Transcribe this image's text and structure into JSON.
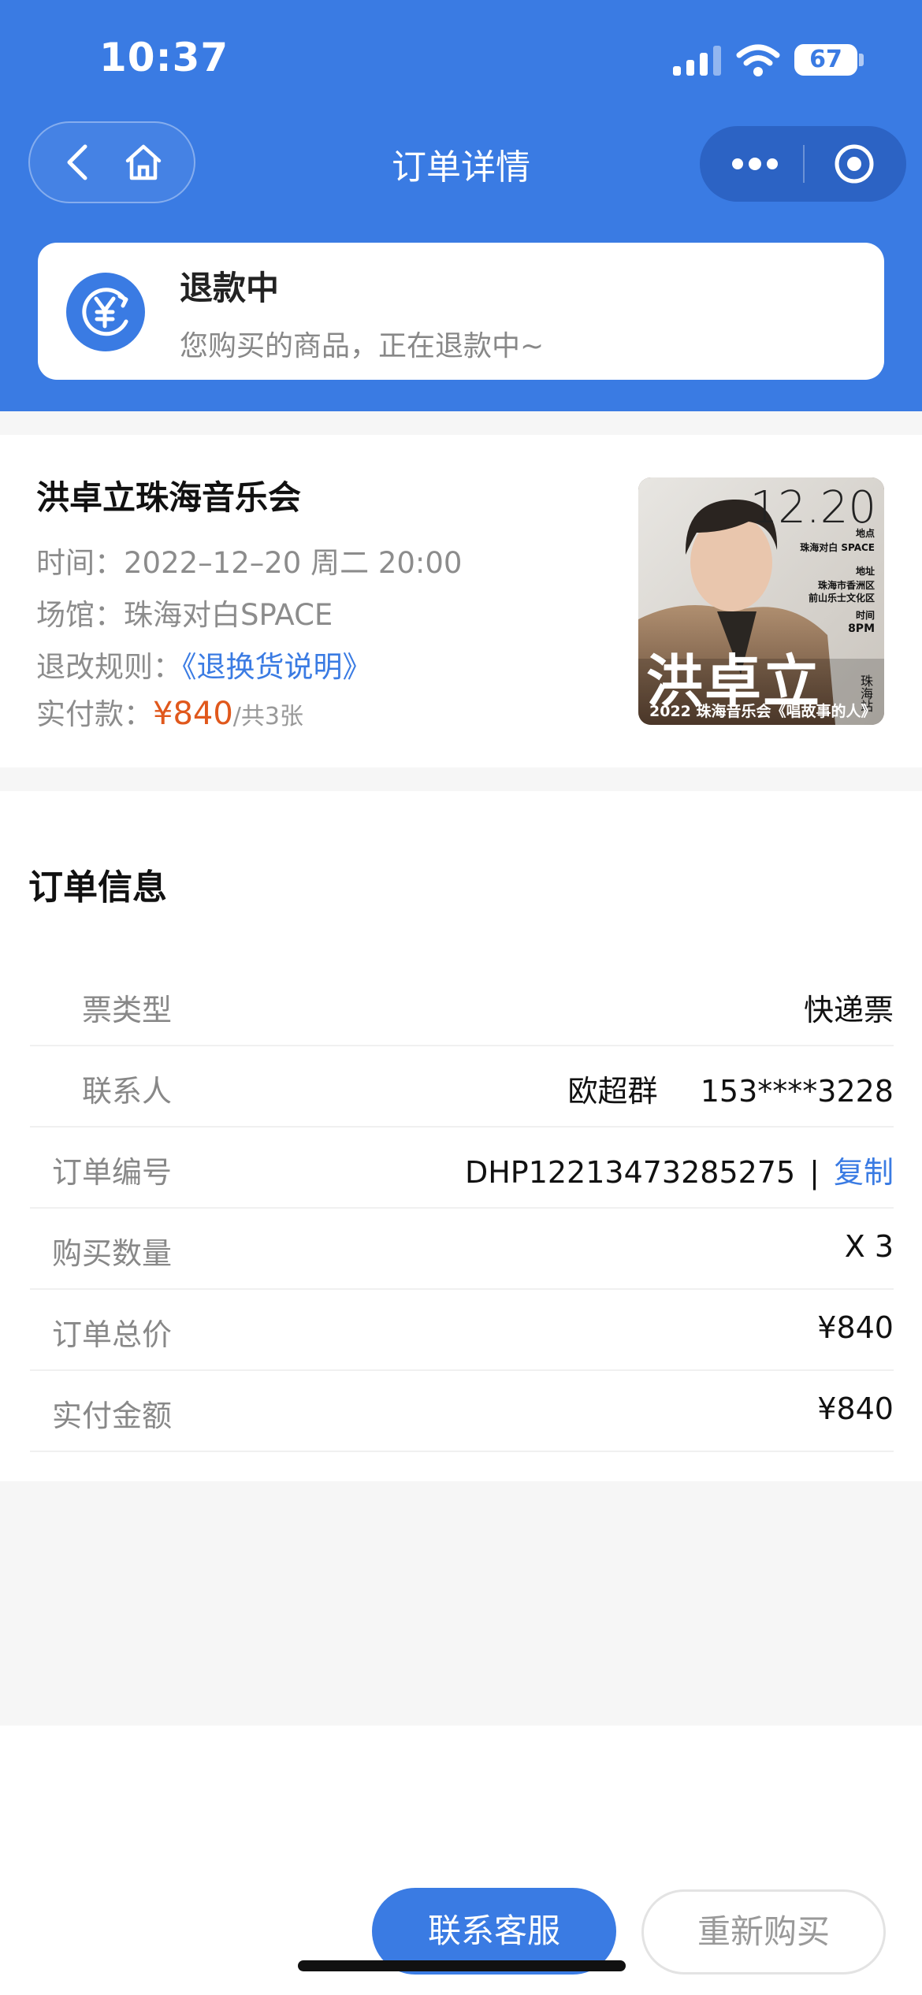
{
  "status_bar": {
    "time": "10:37",
    "battery": "67"
  },
  "nav": {
    "title": "订单详情"
  },
  "refund": {
    "title": "退款中",
    "description": "您购买的商品，正在退款中~"
  },
  "event": {
    "name": "洪卓立珠海音乐会",
    "time_label": "时间：",
    "time_value": "2022–12–20 周二 20:00",
    "venue_label": "场馆：",
    "venue_value": "珠海对白SPACE",
    "rules_label": "退改规则：",
    "rules_link": "《退换货说明》",
    "paid_label": "实付款：",
    "paid_value": "¥840",
    "paid_count": "/共3张"
  },
  "poster": {
    "date": "12.20",
    "tag_place": "地点",
    "venue": "珠海对白 SPACE",
    "tag_address": "地址",
    "address_1": "珠海市香洲区",
    "address_2": "前山乐士文化区",
    "tag_time": "时间",
    "time": "8PM",
    "artist": "洪卓立",
    "subtitle": "2022 珠海音乐会《唱故事的人》",
    "station": "珠海站"
  },
  "order_info": {
    "title": "订单信息",
    "rows": [
      {
        "label": "票类型",
        "value": "快递票"
      },
      {
        "label": "联系人",
        "contact_name": "欧超群",
        "contact_phone": "153****3228"
      },
      {
        "label": "订单编号",
        "value": "DHP12213473285275",
        "separator": "|",
        "copy_label": "复制"
      },
      {
        "label": "购买数量",
        "value": "X 3"
      },
      {
        "label": "订单总价",
        "value": "¥840"
      },
      {
        "label": "实付金额",
        "value": "¥840"
      }
    ]
  },
  "actions": {
    "contact_service": "联系客服",
    "buy_again": "重新购买"
  },
  "colors": {
    "brand_blue": "#3a7be3",
    "price_orange": "#e0581c"
  }
}
